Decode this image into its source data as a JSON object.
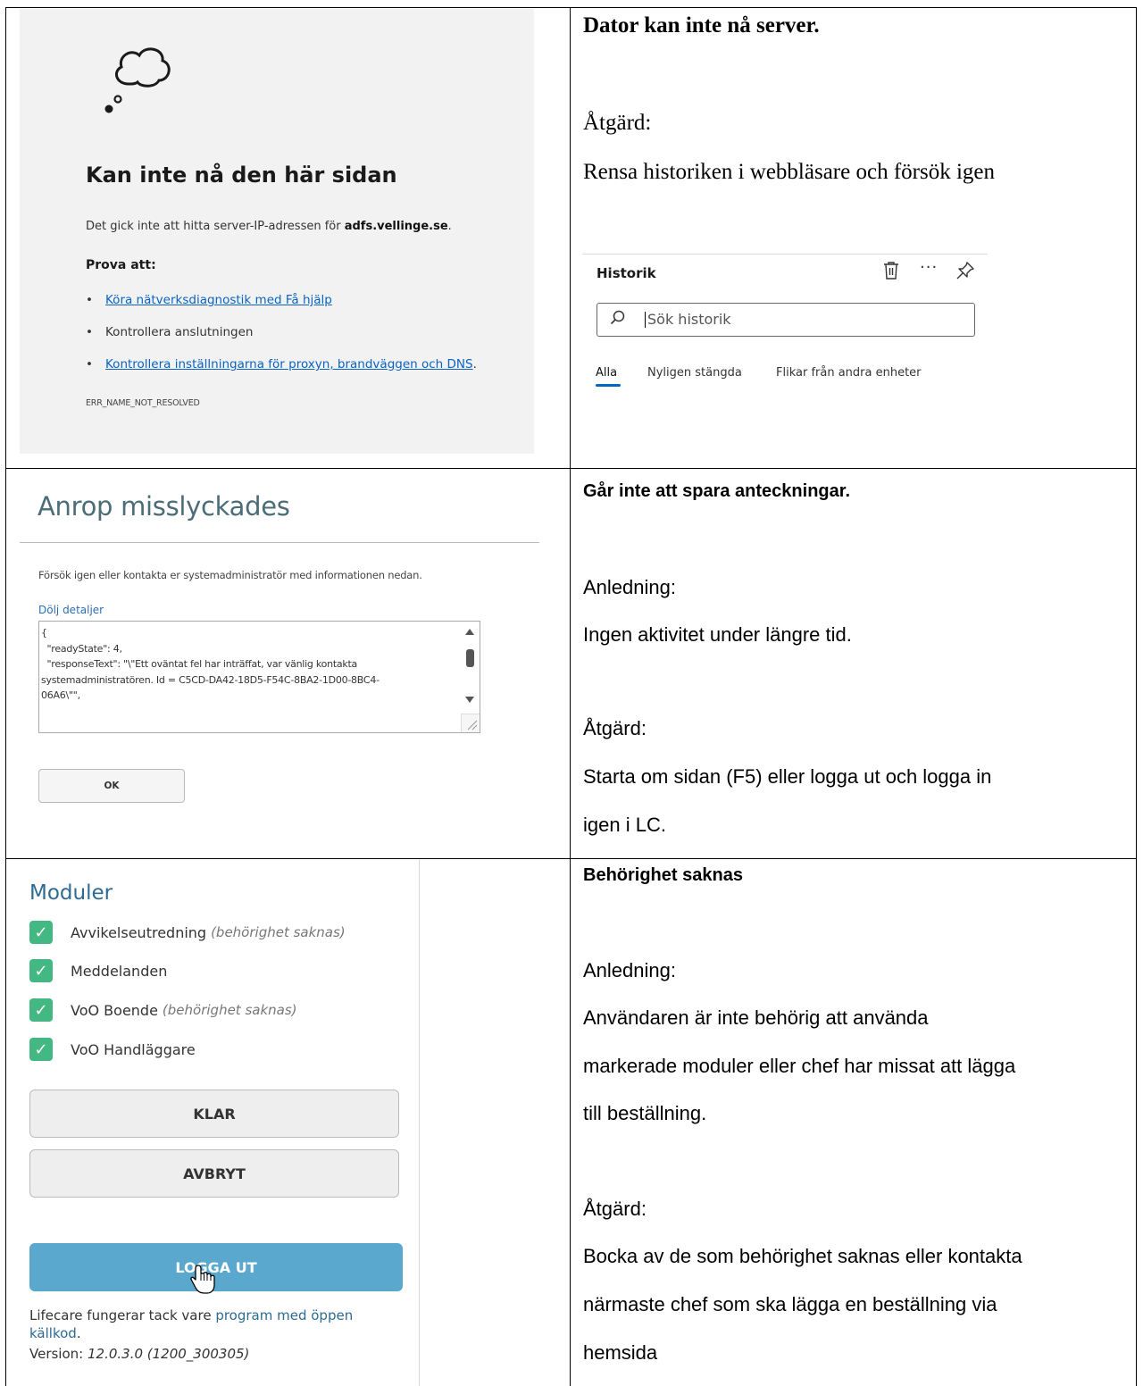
{
  "row1": {
    "browser_error": {
      "title": "Kan inte nå den här sidan",
      "desc_prefix": "Det gick inte att hitta server-IP-adressen för ",
      "desc_host": "adfs.vellinge.se",
      "desc_suffix": ".",
      "try_heading": "Prova att:",
      "items": [
        {
          "text": "Köra nätverksdiagnostik med Få hjälp"
        },
        {
          "text": "Kontrollera anslutningen"
        },
        {
          "text": "Kontrollera inställningarna för proxyn, brandväggen och DNS"
        }
      ],
      "item3_suffix": ".",
      "error_code": "ERR_NAME_NOT_RESOLVED"
    },
    "heading": "Dator kan inte nå server.",
    "action_label": "Åtgärd:",
    "action_text": "Rensa historiken i webbläsare och försök igen",
    "history_panel": {
      "title": "Historik",
      "search_placeholder": "Sök historik",
      "tabs": [
        "Alla",
        "Nyligen stängda",
        "Flikar från andra enheter"
      ]
    }
  },
  "row2": {
    "dialog": {
      "title": "Anrop misslyckades",
      "message": "Försök igen eller kontakta er systemadministratör med informationen nedan.",
      "toggle_link": "Dölj detaljer",
      "details": "{\n  \"readyState\": 4,\n  \"responseText\": \"\\\"Ett oväntat fel har inträffat, var vänlig kontakta\nsystemadministratören. Id = C5CD-DA42-18D5-F54C-8BA2-1D00-8BC4-\n06A6\\\"\",",
      "ok_label": "OK"
    },
    "heading": "Går inte att spara anteckningar.",
    "reason_label": "Anledning:",
    "reason_text": "Ingen aktivitet under längre tid.",
    "action_label": "Åtgärd:",
    "action_line1": "Starta om sidan (F5) eller logga ut och logga in",
    "action_line2": "igen i LC."
  },
  "row3": {
    "modules": {
      "title": "Moduler",
      "items": [
        {
          "label": "Avvikelseutredning",
          "note": "(behörighet saknas)"
        },
        {
          "label": "Meddelanden",
          "note": ""
        },
        {
          "label": "VoO Boende",
          "note": "(behörighet saknas)"
        },
        {
          "label": "VoO Handläggare",
          "note": ""
        }
      ],
      "btn_done": "KLAR",
      "btn_cancel": "AVBRYT",
      "btn_logout": "LOGGA UT",
      "footer_prefix": "Lifecare fungerar tack vare ",
      "footer_link_1": "program med öppen",
      "footer_link_2": "källkod",
      "footer_suffix": ".",
      "version_label": "Version: ",
      "version_value": "12.0.3.0 (1200_300305)"
    },
    "heading": "Behörighet saknas",
    "reason_label": "Anledning:",
    "reason_lines": [
      "Användaren är inte behörig att använda",
      "markerade moduler eller chef har missat att lägga",
      "till beställning."
    ],
    "action_label": "Åtgärd:",
    "action_lines": [
      "Bocka av de som behörighet saknas eller kontakta",
      "närmaste chef som ska lägga en beställning via",
      "hemsida"
    ]
  }
}
